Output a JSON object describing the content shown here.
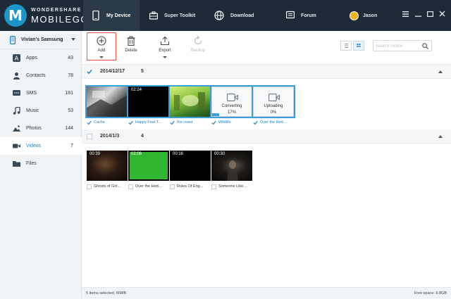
{
  "app": {
    "logo_mark": "M",
    "logo_top": "WONDERSHARE",
    "logo_bottom": "MOBILEGO"
  },
  "nav": {
    "tabs": [
      {
        "label": "My Device",
        "icon": "phone-icon",
        "active": true
      },
      {
        "label": "Super Toolkit",
        "icon": "toolbox-icon"
      },
      {
        "label": "Download",
        "icon": "globe-icon"
      },
      {
        "label": "Forum",
        "icon": "chat-icon"
      }
    ],
    "user": "Jason",
    "window_controls": [
      "menu-icon",
      "minimize-icon",
      "maximize-icon",
      "close-icon"
    ]
  },
  "sidebar": {
    "device_name": "Vivian's Samsung",
    "items": [
      {
        "label": "Apps",
        "count": "43",
        "icon": "apps-icon"
      },
      {
        "label": "Contacts",
        "count": "78",
        "icon": "contacts-icon"
      },
      {
        "label": "SMS",
        "count": "181",
        "icon": "sms-icon"
      },
      {
        "label": "Music",
        "count": "53",
        "icon": "music-icon"
      },
      {
        "label": "Photos",
        "count": "144",
        "icon": "photos-icon"
      },
      {
        "label": "Videos",
        "count": "7",
        "icon": "video-camera-icon",
        "active": true
      },
      {
        "label": "Files",
        "count": "",
        "icon": "folder-icon"
      }
    ]
  },
  "toolbar": {
    "add_label": "Add",
    "delete_label": "Delete",
    "export_label": "Export",
    "backup_label": "Backup",
    "search_placeholder": "Search Videos",
    "accent_color": "#3a9fd8",
    "highlight_color": "#e8564a"
  },
  "groups": [
    {
      "date": "2014/12/17",
      "count": "5",
      "expanded": true,
      "checked": true,
      "items": [
        {
          "title": "Cache",
          "duration": "",
          "selected": true
        },
        {
          "title": "Happy Feet T...",
          "duration": "02:24",
          "selected": true
        },
        {
          "title": "the coast",
          "duration": "",
          "selected": true
        },
        {
          "title": "Wildlife",
          "state": "Converting",
          "percent": "17%",
          "progress": 0.17,
          "selected": true
        },
        {
          "title": "Over the Hed...",
          "state": "Uploading",
          "percent": "0%",
          "progress": 0,
          "selected": true
        }
      ]
    },
    {
      "date": "2014/1/3",
      "count": "4",
      "expanded": true,
      "checked": false,
      "items": [
        {
          "title": "Ghosts of Girl...",
          "duration": "00:39",
          "selected": false
        },
        {
          "title": "Over the Hed...",
          "duration": "02:06",
          "selected": false
        },
        {
          "title": "Rules Of Eng...",
          "duration": "00:16",
          "selected": false
        },
        {
          "title": "Someone Like...",
          "duration": "00:30",
          "selected": false
        }
      ]
    }
  ],
  "status": {
    "selection": "5 items selected, 66MB",
    "free_space": "Free space: 9.8GB"
  }
}
